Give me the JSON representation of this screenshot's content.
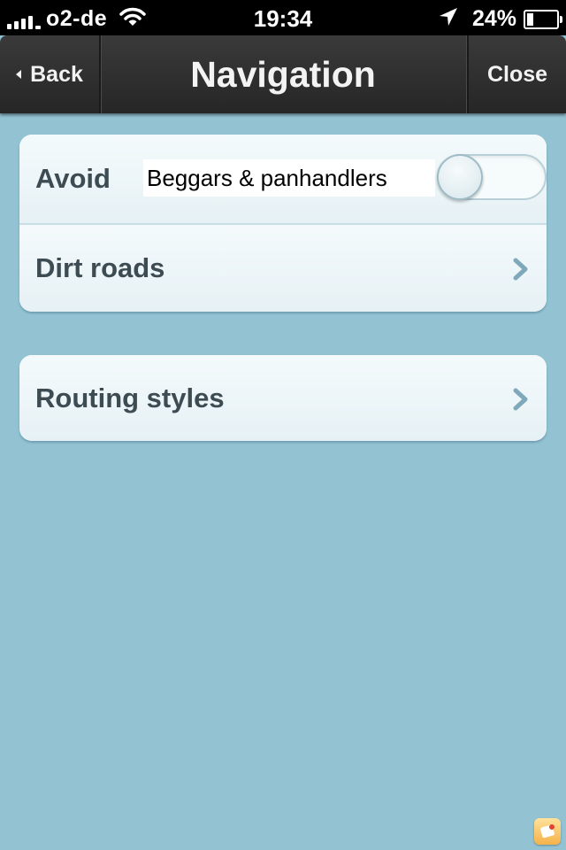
{
  "status_bar": {
    "carrier": "o2-de",
    "time": "19:34",
    "battery_percent": "24%",
    "battery_level": 0.24,
    "icons": [
      "signal-icon",
      "wifi-icon",
      "location-arrow-icon",
      "battery-icon"
    ]
  },
  "navbar": {
    "back_label": "Back",
    "title": "Navigation",
    "close_label": "Close"
  },
  "group1": {
    "avoid_label": "Avoid",
    "avoid_value": "Beggars & panhandlers",
    "avoid_toggle_on": false,
    "dirt_roads_label": "Dirt roads"
  },
  "group2": {
    "routing_styles_label": "Routing styles"
  },
  "colors": {
    "background": "#93c3d3",
    "navbar": "#2e2e2e",
    "cell": "#eef6f9",
    "cell_text": "#3d4c52",
    "chevron": "#7fa9ba"
  }
}
